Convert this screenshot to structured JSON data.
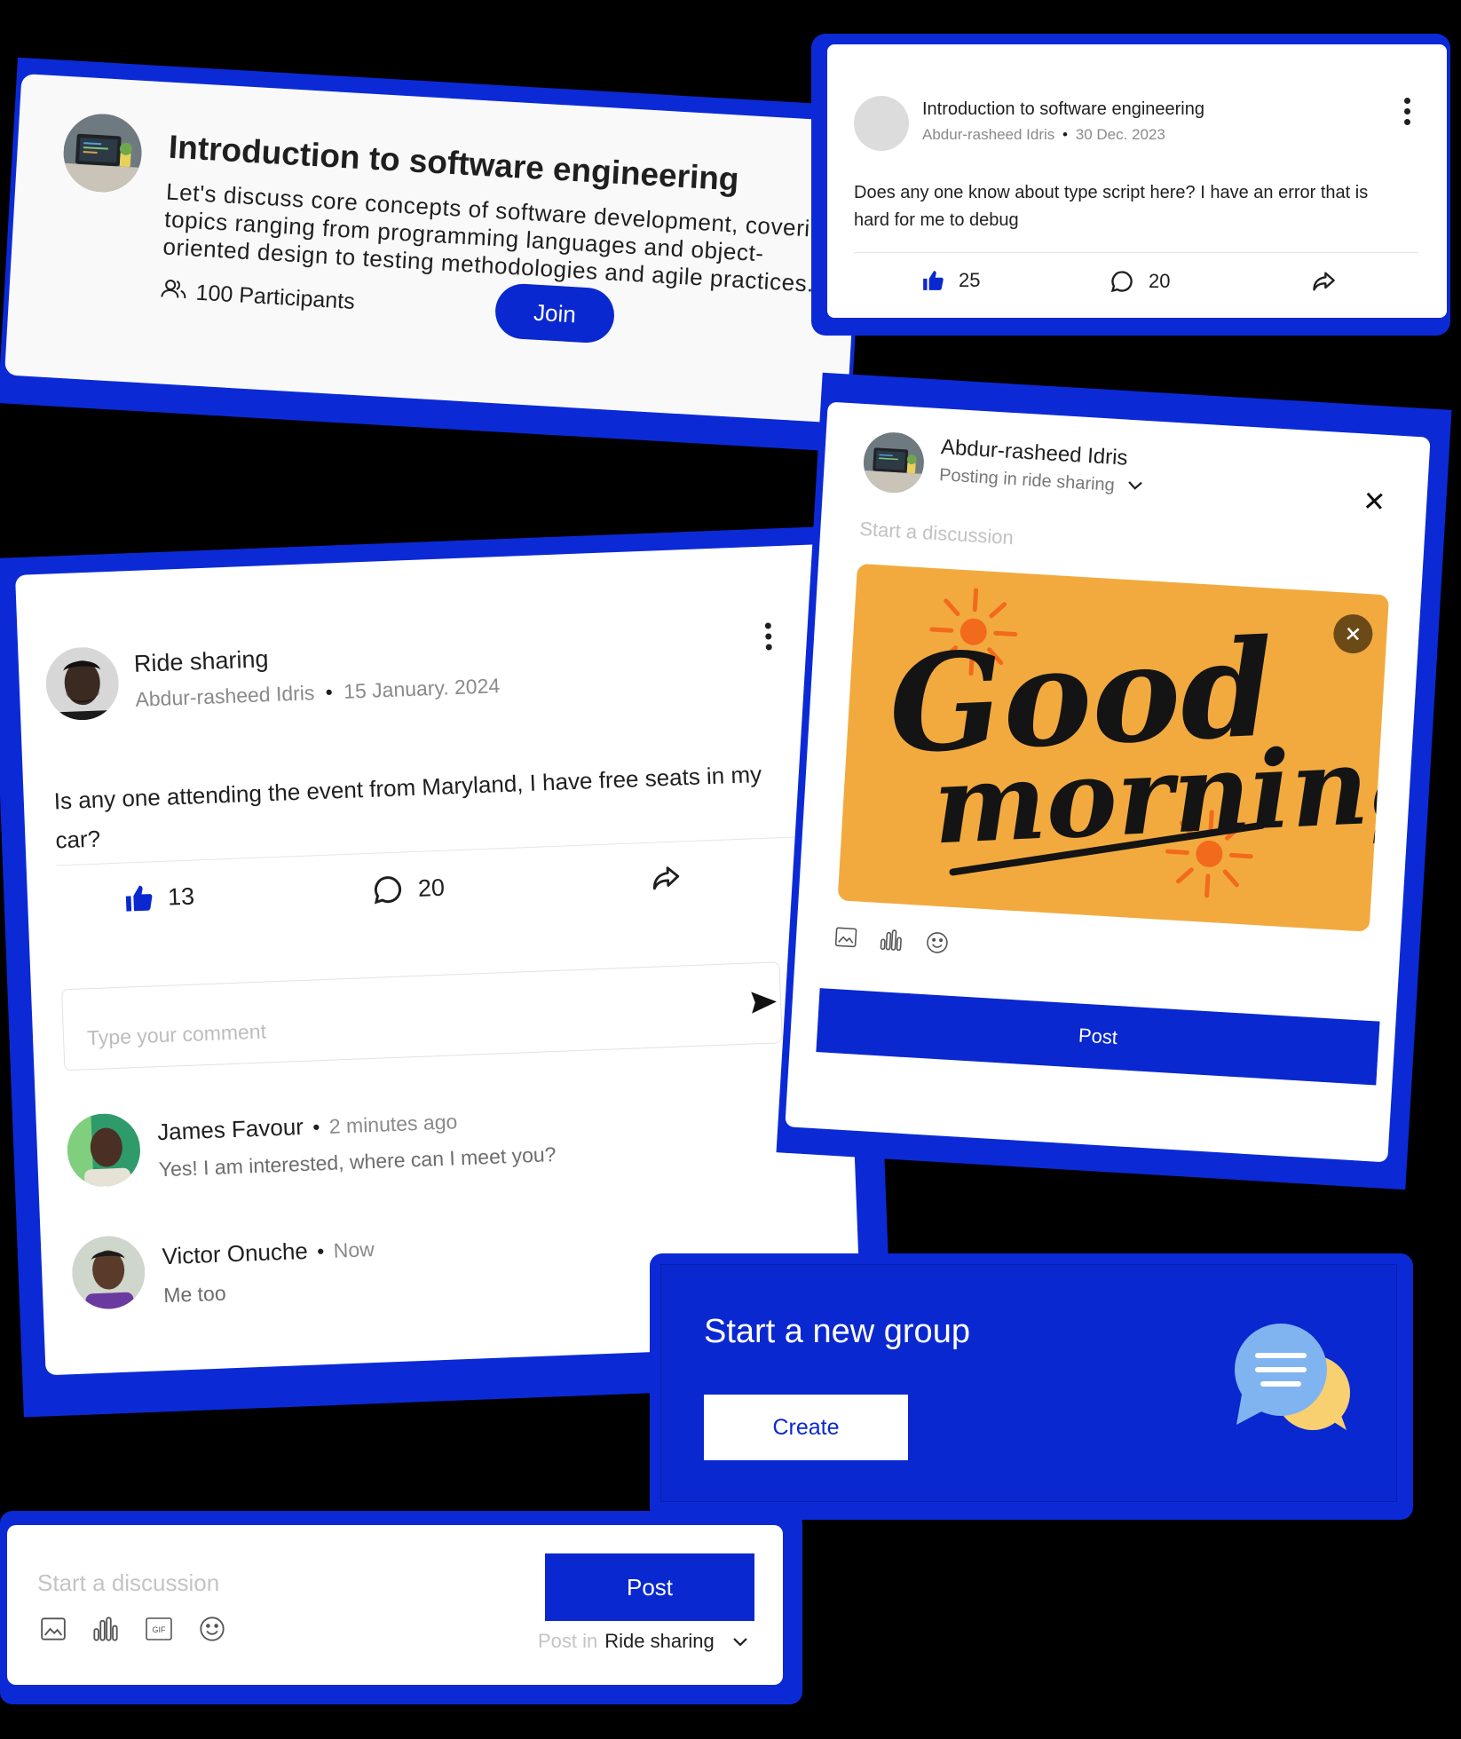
{
  "group_card": {
    "title": "Introduction to software engineering",
    "description_lines": [
      "Let's discuss core concepts of software development, covering",
      "topics ranging from programming languages and object-",
      "oriented design to testing methodologies and agile practices."
    ],
    "participants": "100 Participants",
    "join_label": "Join",
    "icons": {
      "participants": "users-icon",
      "avatar": "laptop-avatar"
    }
  },
  "question_post": {
    "group": "Introduction to software engineering",
    "author": "Abdur-rasheed Idris",
    "separator": "•",
    "date": "30 Dec. 2023",
    "body": "Does any one know about type script here? I have an error that is hard for me to debug",
    "likes": "25",
    "comments": "20",
    "icons": {
      "like": "thumbs-up-icon",
      "comment": "comment-icon",
      "share": "share-icon",
      "menu": "more-vertical-icon"
    }
  },
  "composer": {
    "author": "Abdur-rasheed Idris",
    "posting_in": "Posting in ride sharing",
    "placeholder": "Start a discussion",
    "image_text_line1": "Good",
    "image_text_line2": "morning",
    "post_label": "Post",
    "icons": {
      "close": "close-icon",
      "remove_image": "close-circle-icon",
      "image": "image-icon",
      "poll": "poll-icon",
      "emoji": "emoji-icon",
      "chevron": "chevron-down-icon"
    }
  },
  "ride_post": {
    "group": "Ride sharing",
    "author": "Abdur-rasheed Idris",
    "separator": "•",
    "date": "15 January. 2024",
    "body": "Is any one attending the event from Maryland, I have free seats in my car?",
    "likes": "13",
    "comments": "20",
    "comment_placeholder": "Type your comment",
    "replies": [
      {
        "name": "James Favour",
        "time": "2 minutes ago",
        "text": "Yes! I am interested, where can I meet you?"
      },
      {
        "name": "Victor Onuche",
        "time": "Now",
        "text": "Me too"
      }
    ]
  },
  "new_group": {
    "title": "Start a new group",
    "create_label": "Create",
    "icons": {
      "illustration": "chat-bubbles-icon"
    }
  },
  "bottom_composer": {
    "placeholder": "Start a discussion",
    "post_label": "Post",
    "post_in_label": "Post in",
    "post_in_value": "Ride sharing",
    "icons": {
      "image": "image-icon",
      "poll": "poll-icon",
      "gif": "gif-icon",
      "emoji": "emoji-icon",
      "chevron": "chevron-down-icon"
    }
  },
  "colors": {
    "brand_blue": "#0a28d0",
    "image_orange": "#f2aa3f",
    "sun_orange": "#f26a1b",
    "bubble_blue": "#7fb4f0",
    "bubble_yellow": "#f8d070"
  }
}
